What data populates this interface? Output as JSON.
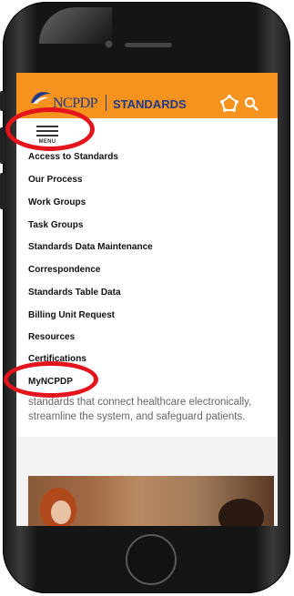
{
  "header": {
    "logo_text": "NCPDP",
    "section_label": "STANDARDS"
  },
  "menu": {
    "label": "MENU"
  },
  "nav": {
    "items": [
      "Access to Standards",
      "Our Process",
      "Work Groups",
      "Task Groups",
      "Standards Data Maintenance",
      "Correspondence",
      "Standards Table Data",
      "Billing Unit Request",
      "Resources",
      "Certifications",
      "MyNCPDP"
    ]
  },
  "content": {
    "line1": "standards that connect healthcare electronically,",
    "line2": "streamline the system, and safeguard patients."
  },
  "colors": {
    "header_bg": "#f6921e",
    "brand_blue": "#1d3b8a",
    "annotation_red": "#e3141b"
  },
  "icons": [
    "network-icon",
    "search-icon",
    "hamburger-menu-icon"
  ]
}
